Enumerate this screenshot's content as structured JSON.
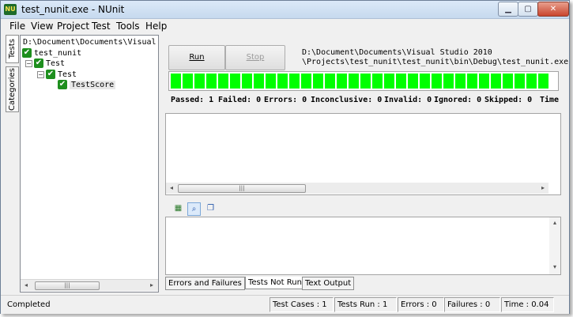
{
  "window": {
    "title": "test_nunit.exe - NUnit",
    "app_icon_text": "NU"
  },
  "menu": [
    "File",
    "View",
    "Project",
    "Test",
    "Tools",
    "Help"
  ],
  "side_tabs": [
    "Tests",
    "Categories"
  ],
  "tree": {
    "root_path": "D:\\Document\\Documents\\Visual Studio",
    "nodes": [
      {
        "label": "test_nunit",
        "status": "passed"
      },
      {
        "label": "Test",
        "status": "passed"
      },
      {
        "label": "Test",
        "status": "passed"
      },
      {
        "label": "TestScore",
        "status": "passed"
      }
    ]
  },
  "run": {
    "run_label": "Run",
    "stop_label": "Stop",
    "path_line1": "D:\\Document\\Documents\\Visual Studio 2010",
    "path_line2": "\\Projects\\test_nunit\\test_nunit\\bin\\Debug\\test_nunit.exe",
    "progress_fraction": 1.0,
    "progress_color": "#00ff00"
  },
  "summary": {
    "passed": "Passed: 1",
    "failed": "Failed: 0",
    "errors": "Errors: 0",
    "inconclusive": "Inconclusive: 0",
    "invalid": "Invalid: 0",
    "ignored": "Ignored: 0",
    "skipped": "Skipped: 0",
    "time": "Time"
  },
  "result_tabs": [
    "Errors and Failures",
    "Tests Not Run",
    "Text Output"
  ],
  "status": {
    "message": "Completed",
    "test_cases": "Test Cases : 1",
    "tests_run": "Tests Run : 1",
    "errors": "Errors : 0",
    "failures": "Failures : 0",
    "time": "Time : 0.04"
  },
  "icons": {
    "scroll_left": "◂",
    "scroll_right": "▸",
    "scroll_up": "▴",
    "scroll_down": "▾",
    "check": "✔",
    "collapse": "−",
    "minimize": "▁",
    "maximize": "▢",
    "close": "✕"
  }
}
